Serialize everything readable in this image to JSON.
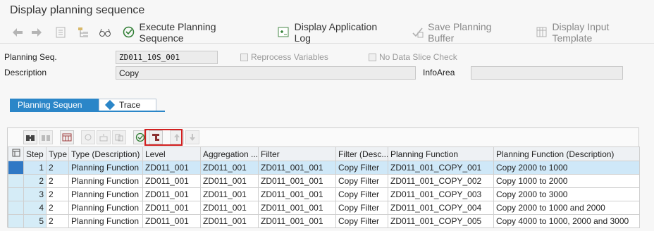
{
  "window": {
    "title": "Display planning sequence"
  },
  "toolbar": {
    "execute_label": "Execute Planning Sequence",
    "display_log_label": "Display Application Log",
    "save_buffer_label": "Save Planning Buffer",
    "display_template_label": "Display Input Template"
  },
  "form": {
    "planning_seq_label": "Planning Seq.",
    "planning_seq_value": "ZD011_10S_001",
    "reprocess_label": "Reprocess Variables",
    "no_data_slice_label": "No Data Slice Check",
    "description_label": "Description",
    "description_value": "Copy",
    "infoarea_label": "InfoArea",
    "infoarea_value": ""
  },
  "tabs": [
    {
      "label": "Planning Sequen"
    },
    {
      "label": "Trace"
    }
  ],
  "grid": {
    "columns": [
      "Step",
      "Type",
      "Type (Description)",
      "Level",
      "Aggregation ...",
      "Filter",
      "Filter (Desc...",
      "Planning Function",
      "Planning Function (Description)"
    ],
    "rows": [
      [
        "1",
        "2",
        "Planning Function",
        "ZD011_001",
        "ZD011_001",
        "ZD011_001_001",
        "Copy Filter",
        "ZD011_001_COPY_001",
        "Copy 2000 to 1000"
      ],
      [
        "2",
        "2",
        "Planning Function",
        "ZD011_001",
        "ZD011_001",
        "ZD011_001_001",
        "Copy Filter",
        "ZD011_001_COPY_002",
        "Copy 1000 to 2000"
      ],
      [
        "3",
        "2",
        "Planning Function",
        "ZD011_001",
        "ZD011_001",
        "ZD011_001_001",
        "Copy Filter",
        "ZD011_001_COPY_003",
        "Copy 2000 to 3000"
      ],
      [
        "4",
        "2",
        "Planning Function",
        "ZD011_001",
        "ZD011_001",
        "ZD011_001_001",
        "Copy Filter",
        "ZD011_001_COPY_004",
        "Copy 2000 to 1000 and 2000"
      ],
      [
        "5",
        "2",
        "Planning Function",
        "ZD011_001",
        "ZD011_001",
        "ZD011_001_001",
        "Copy Filter",
        "ZD011_001_COPY_005",
        "Copy 4000 to 1000, 2000 and 3000"
      ]
    ]
  },
  "colors": {
    "accent": "#2b86c8",
    "highlight": "#d21f1f",
    "selected_row": "#cfe8f8"
  }
}
